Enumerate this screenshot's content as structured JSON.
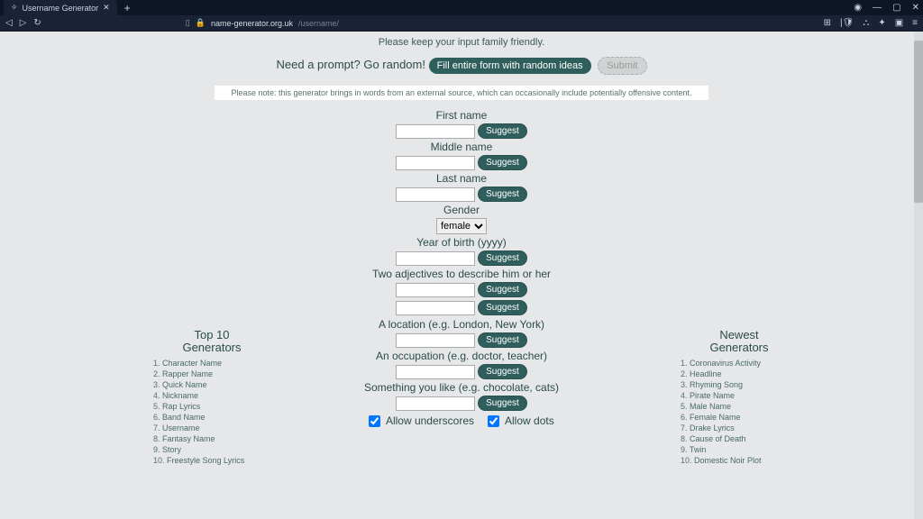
{
  "browser": {
    "tab_title": "Username Generator",
    "url_domain": "name-generator.org.uk",
    "url_path": "/username/"
  },
  "note_family": "Please keep your input family friendly.",
  "prompt_prefix": "Need a prompt? Go random!",
  "fill_btn": "Fill entire form with random ideas",
  "submit_btn": "Submit",
  "disclaimer": "Please note: this generator brings in words from an external source, which can occasionally include potentially offensive content.",
  "labels": {
    "first_name": "First name",
    "middle_name": "Middle name",
    "last_name": "Last name",
    "gender": "Gender",
    "yob": "Year of birth (yyyy)",
    "adjectives": "Two adjectives to describe him or her",
    "location": "A location (e.g. London, New York)",
    "occupation": "An occupation (e.g. doctor, teacher)",
    "like": "Something you like (e.g. chocolate, cats)",
    "allow_underscores": "Allow underscores",
    "allow_dots": "Allow dots",
    "suggest": "Suggest"
  },
  "gender_value": "female",
  "sidebars": {
    "top10": {
      "title": "Top 10 Generators",
      "items": [
        "Character Name",
        "Rapper Name",
        "Quick Name",
        "Nickname",
        "Rap Lyrics",
        "Band Name",
        "Username",
        "Fantasy Name",
        "Story",
        "Freestyle Song Lyrics"
      ]
    },
    "newest": {
      "title": "Newest Generators",
      "items": [
        "Coronavirus Activity",
        "Headline",
        "Rhyming Song",
        "Pirate Name",
        "Male Name",
        "Female Name",
        "Drake Lyrics",
        "Cause of Death",
        "Twin",
        "Domestic Noir Plot"
      ]
    }
  }
}
